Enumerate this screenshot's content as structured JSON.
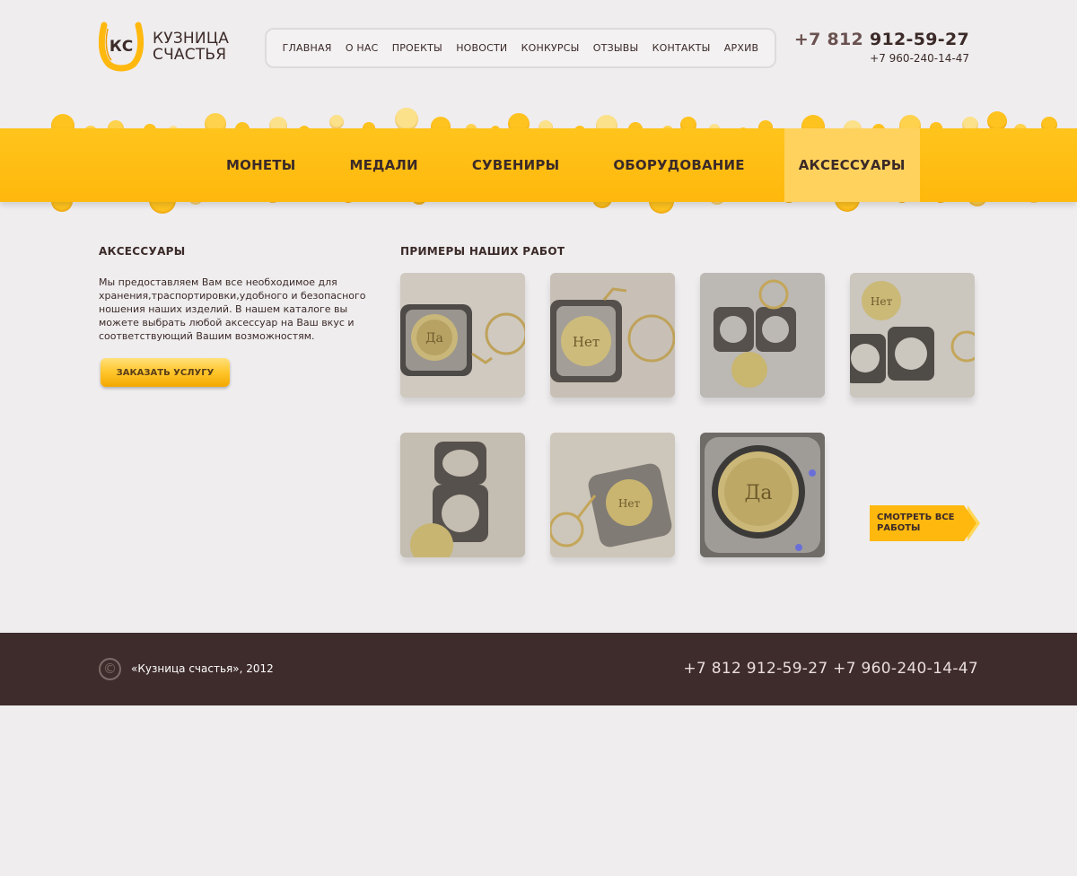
{
  "logo": {
    "line1": "КУЗНИЦА",
    "line2": "СЧАСТЬЯ",
    "mark": "КС"
  },
  "topnav": [
    "ГЛАВНАЯ",
    "О НАС",
    "ПРОЕКТЫ",
    "НОВОСТИ",
    "КОНКУРСЫ",
    "ОТЗЫВЫ",
    "КОНТАКТЫ",
    "АРХИВ"
  ],
  "phones": {
    "code": "+7 812",
    "main": "912-59-27",
    "alt": "+7 960-240-14-47"
  },
  "catnav": {
    "items": [
      "МОНЕТЫ",
      "МЕДАЛИ",
      "СУВЕНИРЫ",
      "ОБОРУДОВАНИЕ",
      "АКСЕССУАРЫ"
    ],
    "active": "АКСЕССУАРЫ"
  },
  "sidebar": {
    "title": "АКСЕССУАРЫ",
    "text": "Мы предоставляем Вам все необходимое для хранения,траспортировки,удобного и безопасного ношения наших изделий. В нашем каталоге вы можете выбрать любой аксессуар на Ваш вкус и соответствующий Вашим возможностям.",
    "button": "ЗАКАЗАТЬ УСЛУГУ"
  },
  "works": {
    "title": "ПРИМЕРЫ НАШИХ РАБОТ",
    "thumbnails": [
      "keychain-photo-1",
      "keychain-photo-2",
      "keychain-photo-3",
      "keychain-photo-4",
      "keychain-photo-5",
      "keychain-photo-6",
      "keychain-photo-7"
    ],
    "see_all_line1": "СМОТРЕТЬ ВСЕ",
    "see_all_line2": "РАБОТЫ"
  },
  "footer": {
    "copyright": "«Кузница счастья», 2012",
    "phones": "+7 812 912-59-27 +7 960-240-14-47"
  },
  "colors": {
    "accent": "#ffb80e",
    "dark": "#3e2b2b",
    "background": "#efedee"
  }
}
